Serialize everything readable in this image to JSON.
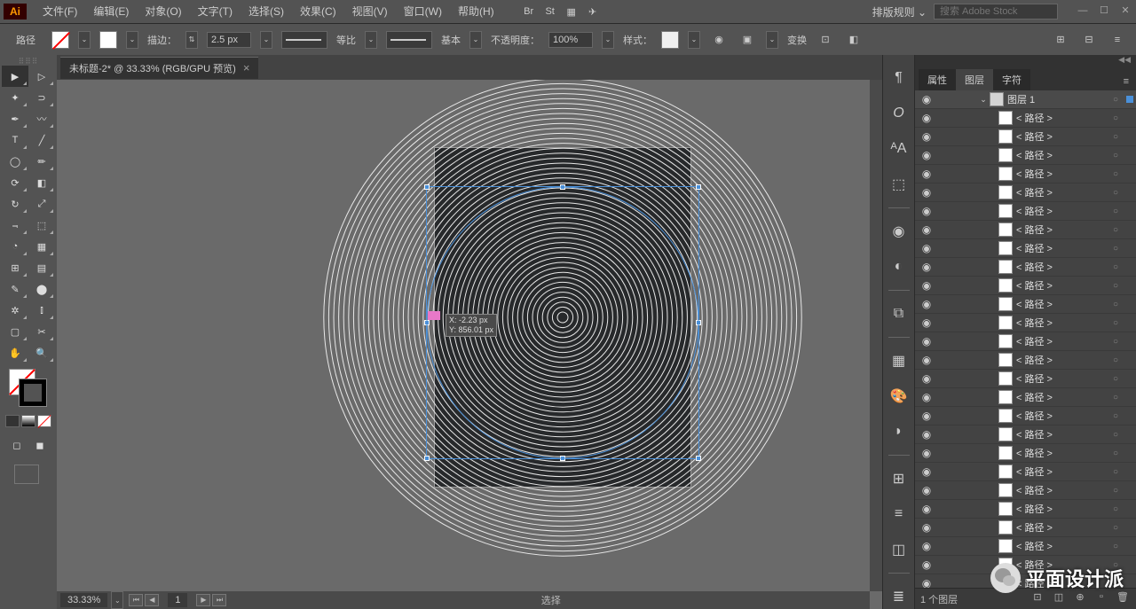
{
  "app": {
    "logo": "Ai"
  },
  "menu": {
    "items": [
      "文件(F)",
      "编辑(E)",
      "对象(O)",
      "文字(T)",
      "选择(S)",
      "效果(C)",
      "视图(V)",
      "窗口(W)",
      "帮助(H)"
    ],
    "layout_preset": "排版规则",
    "search_placeholder": "搜索 Adobe Stock"
  },
  "control": {
    "object_type": "路径",
    "stroke_label": "描边：",
    "stroke_width": "2.5 px",
    "profile_label": "等比",
    "brush_label": "基本",
    "opacity_label": "不透明度：",
    "opacity_value": "100%",
    "style_label": "样式：",
    "transform_label": "变换"
  },
  "document": {
    "tab_title": "未标题-2* @ 33.33% (RGB/GPU 预览)",
    "zoom": "33.33%",
    "page": "1",
    "status_mode": "选择",
    "coord_tip_x": "X: -2.23 px",
    "coord_tip_y": "Y: 856.01 px"
  },
  "panels": {
    "tabs": [
      "属性",
      "图层",
      "字符"
    ],
    "active_tab": 1,
    "parent_layer": "图层 1",
    "path_item_label": "< 路径 >",
    "path_count": 26,
    "footer_text": "1 个图层"
  },
  "watermark": "平面设计派"
}
